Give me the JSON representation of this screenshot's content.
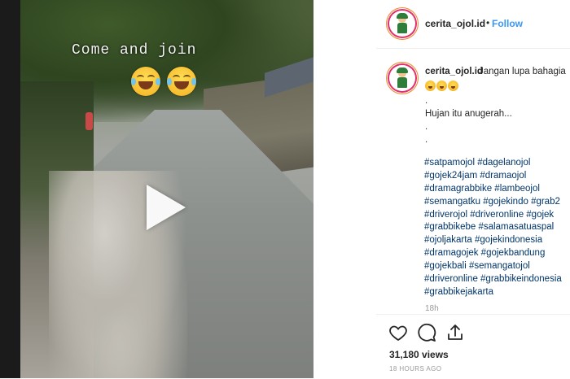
{
  "video": {
    "caption_overlay": "Come and join"
  },
  "header": {
    "username": "cerita_ojol.id",
    "separator": "•",
    "follow_label": "Follow"
  },
  "post": {
    "username": "cerita_ojol.id",
    "text": "Jangan lupa bahagia",
    "lines": [
      ".",
      "Hujan itu anugerah...",
      ".",
      "."
    ],
    "hashtags": [
      "#satpamojol #dagelanojol",
      "#gojek24jam #dramaojol",
      "#dramagrabbike #lambeojol",
      "#semangatku #gojekindo #grab2",
      "#driverojol #driveronline #gojek",
      "#grabbikebe #salamasatuaspal",
      "#ojoljakarta #gojekindonesia",
      "#dramagojek #gojekbandung",
      "#gojekbali #semangatojol",
      "#driveronline #grabbikeindonesia",
      "#grabbikejakarta"
    ],
    "comment_time": "18h"
  },
  "stats": {
    "views": "31,180 views",
    "time_ago": "18 HOURS AGO"
  },
  "icons": {
    "like": "heart-icon",
    "comment": "comment-bubble-icon",
    "share": "share-icon",
    "play": "play-icon"
  },
  "colors": {
    "accent_link": "#3897f0",
    "hashtag": "#003569",
    "text": "#262626",
    "muted": "#999999"
  }
}
